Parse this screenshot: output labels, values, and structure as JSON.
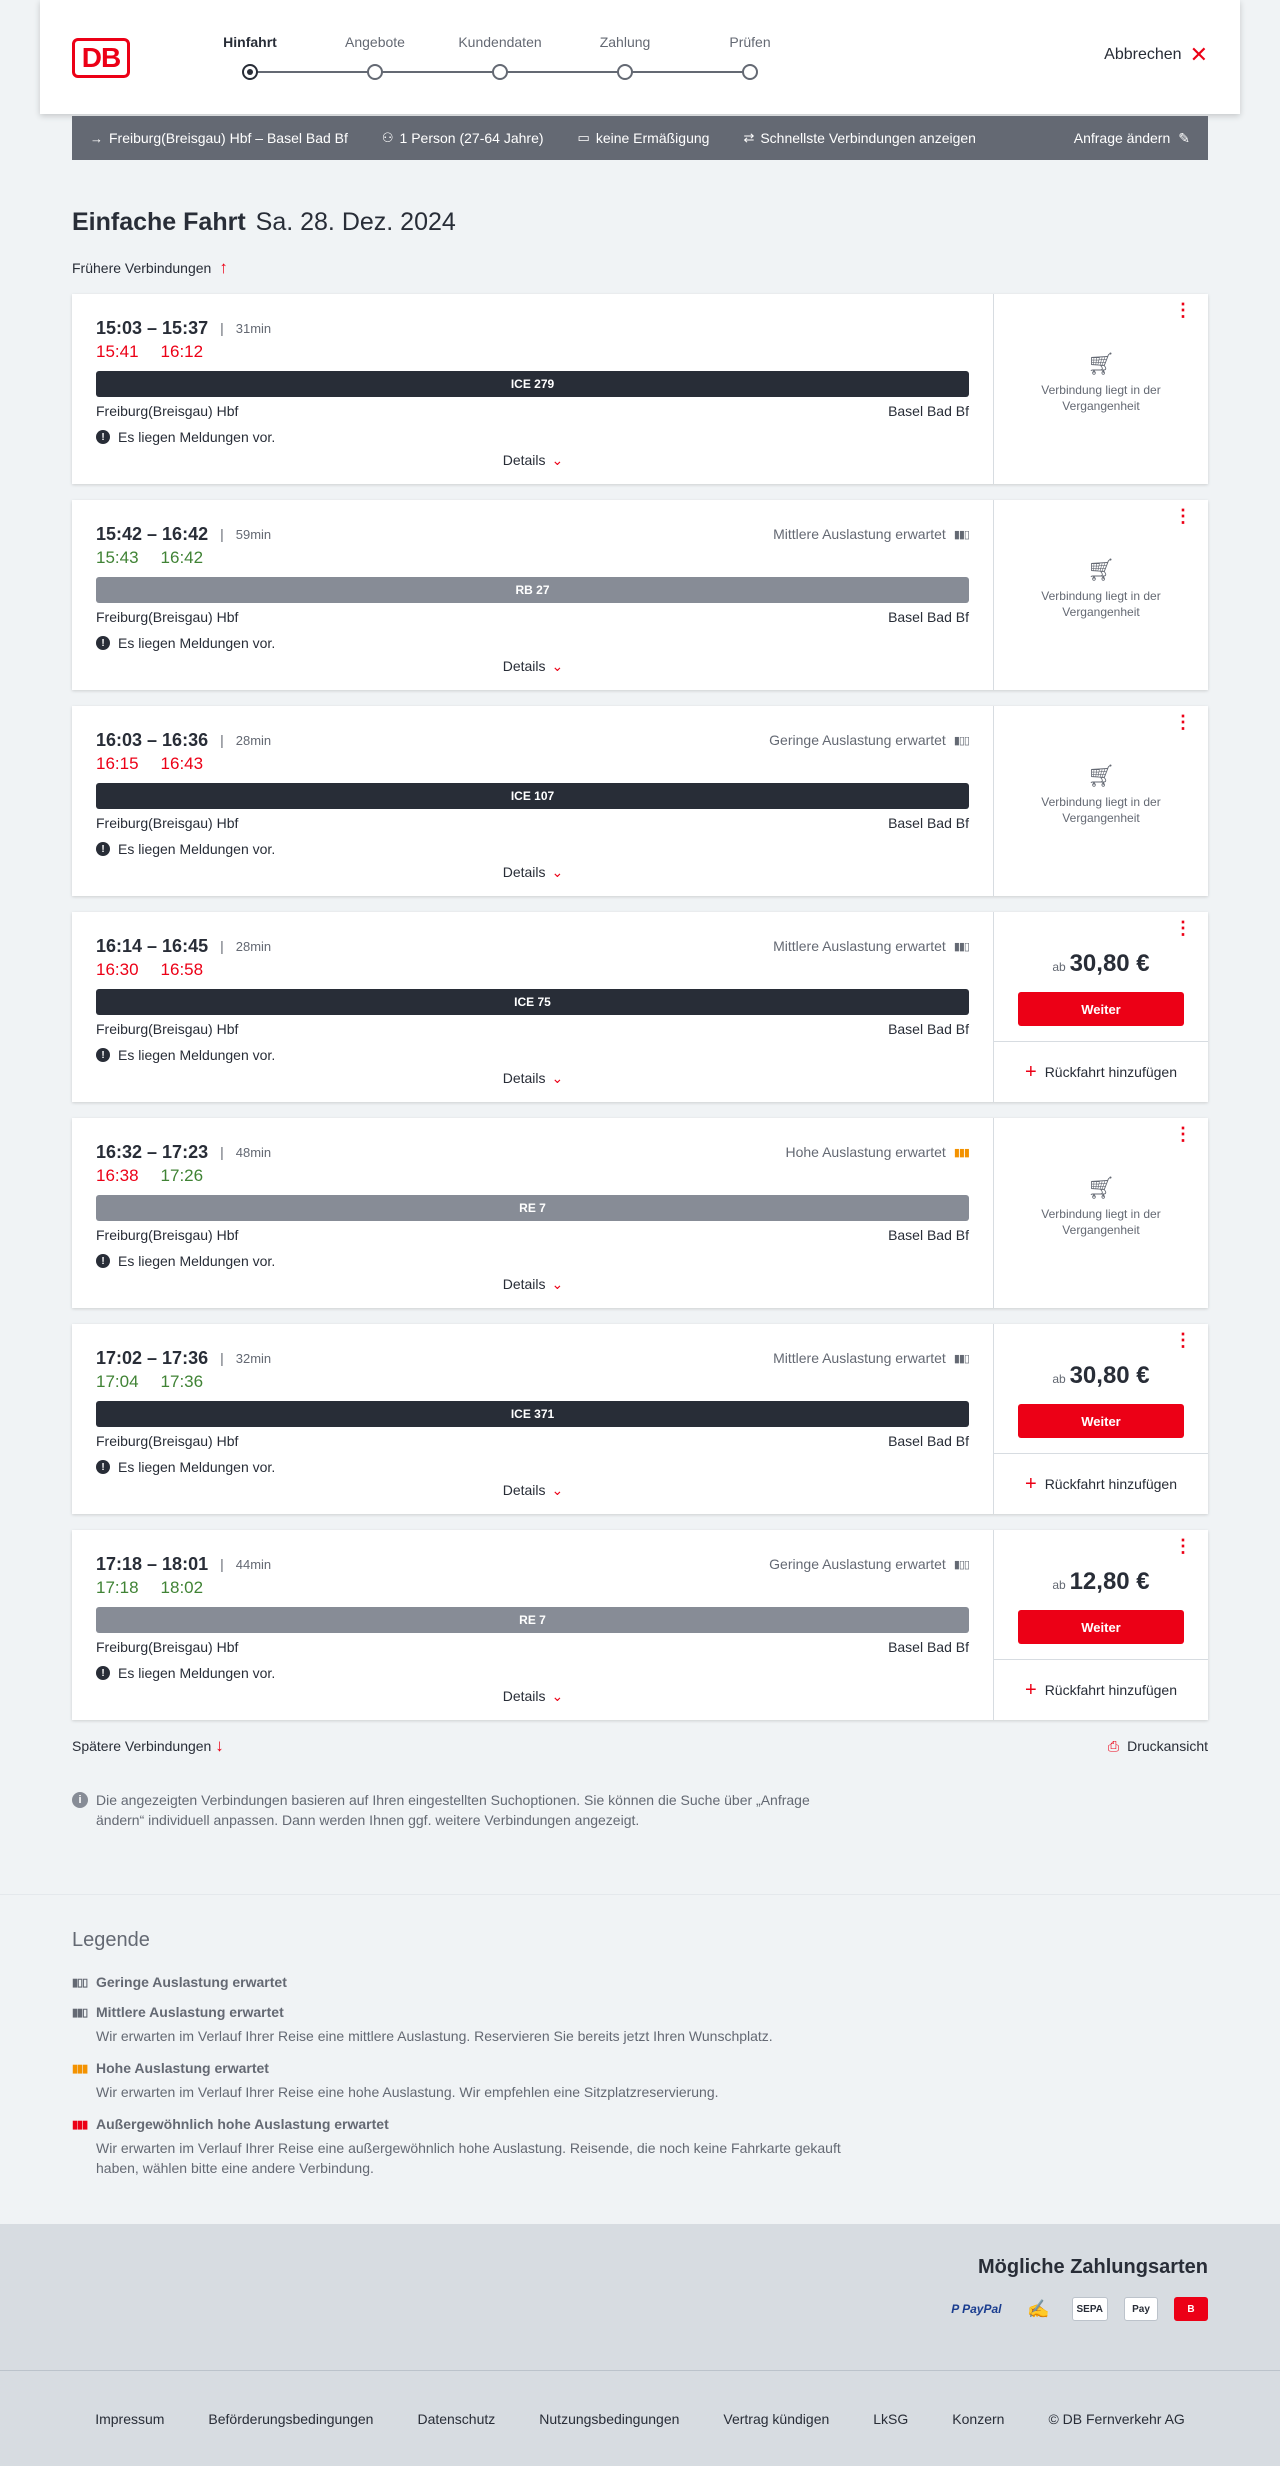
{
  "header": {
    "logo": "DB",
    "steps": [
      {
        "label": "Hinfahrt",
        "active": true
      },
      {
        "label": "Angebote",
        "active": false
      },
      {
        "label": "Kundendaten",
        "active": false
      },
      {
        "label": "Zahlung",
        "active": false
      },
      {
        "label": "Prüfen",
        "active": false
      }
    ],
    "cancel_label": "Abbrechen"
  },
  "search": {
    "route": "Freiburg(Breisgau) Hbf – Basel Bad Bf",
    "passengers": "1 Person (27-64 Jahre)",
    "discount": "keine Ermäßigung",
    "fastest": "Schnellste Verbindungen anzeigen",
    "edit": "Anfrage ändern"
  },
  "title": {
    "main": "Einfache Fahrt",
    "date": "Sa. 28. Dez. 2024"
  },
  "earlier_label": "Frühere Verbindungen",
  "later_label": "Spätere Verbindungen",
  "print_label": "Druckansicht",
  "labels": {
    "details": "Details",
    "messages": "Es liegen Meldungen vor.",
    "past": "Verbindung liegt in der Vergangenheit",
    "from_prefix": "ab",
    "weiter": "Weiter",
    "return": "Rückfahrt hinzufügen"
  },
  "connections": [
    {
      "times": "15:03 – 15:37",
      "duration": "31min",
      "rt_dep": "15:41",
      "rt_arr": "16:12",
      "dep_late": true,
      "arr_late": true,
      "load": "",
      "load_level": "",
      "train": "ICE 279",
      "kind": "ice",
      "from": "Freiburg(Breisgau) Hbf",
      "to": "Basel Bad Bf",
      "price": ""
    },
    {
      "times": "15:42 – 16:42",
      "duration": "59min",
      "rt_dep": "15:43",
      "rt_arr": "16:42",
      "dep_late": false,
      "arr_late": false,
      "load": "Mittlere Auslastung erwartet",
      "load_level": "mid",
      "train": "RB 27",
      "kind": "reg",
      "from": "Freiburg(Breisgau) Hbf",
      "to": "Basel Bad Bf",
      "price": ""
    },
    {
      "times": "16:03 – 16:36",
      "duration": "28min",
      "rt_dep": "16:15",
      "rt_arr": "16:43",
      "dep_late": true,
      "arr_late": true,
      "load": "Geringe Auslastung erwartet",
      "load_level": "low",
      "train": "ICE 107",
      "kind": "ice",
      "from": "Freiburg(Breisgau) Hbf",
      "to": "Basel Bad Bf",
      "price": ""
    },
    {
      "times": "16:14 – 16:45",
      "duration": "28min",
      "rt_dep": "16:30",
      "rt_arr": "16:58",
      "dep_late": true,
      "arr_late": true,
      "load": "Mittlere Auslastung erwartet",
      "load_level": "mid",
      "train": "ICE 75",
      "kind": "ice",
      "from": "Freiburg(Breisgau) Hbf",
      "to": "Basel Bad Bf",
      "price": "30,80 €"
    },
    {
      "times": "16:32 – 17:23",
      "duration": "48min",
      "rt_dep": "16:38",
      "rt_arr": "17:26",
      "dep_late": true,
      "arr_late": false,
      "load": "Hohe Auslastung erwartet",
      "load_level": "high",
      "train": "RE 7",
      "kind": "reg",
      "from": "Freiburg(Breisgau) Hbf",
      "to": "Basel Bad Bf",
      "price": ""
    },
    {
      "times": "17:02 – 17:36",
      "duration": "32min",
      "rt_dep": "17:04",
      "rt_arr": "17:36",
      "dep_late": false,
      "arr_late": false,
      "load": "Mittlere Auslastung erwartet",
      "load_level": "mid",
      "train": "ICE 371",
      "kind": "ice",
      "from": "Freiburg(Breisgau) Hbf",
      "to": "Basel Bad Bf",
      "price": "30,80 €"
    },
    {
      "times": "17:18 – 18:01",
      "duration": "44min",
      "rt_dep": "17:18",
      "rt_arr": "18:02",
      "dep_late": false,
      "arr_late": false,
      "load": "Geringe Auslastung erwartet",
      "load_level": "low",
      "train": "RE 7",
      "kind": "reg",
      "from": "Freiburg(Breisgau) Hbf",
      "to": "Basel Bad Bf",
      "price": "12,80 €"
    }
  ],
  "info_text": "Die angezeigten Verbindungen basieren auf Ihren eingestellten Suchoptionen. Sie können die Suche über „Anfrage ändern“ individuell anpassen. Dann werden Ihnen ggf. weitere Verbindungen angezeigt.",
  "legend": {
    "title": "Legende",
    "items": [
      {
        "level": "low",
        "title": "Geringe Auslastung erwartet",
        "desc": ""
      },
      {
        "level": "mid",
        "title": "Mittlere Auslastung erwartet",
        "desc": "Wir erwarten im Verlauf Ihrer Reise eine mittlere Auslastung. Reservieren Sie bereits jetzt Ihren Wunschplatz."
      },
      {
        "level": "high",
        "title": "Hohe Auslastung erwartet",
        "desc": "Wir erwarten im Verlauf Ihrer Reise eine hohe Auslastung. Wir empfehlen eine Sitzplatzreservierung."
      },
      {
        "level": "xhigh",
        "title": "Außergewöhnlich hohe Auslastung erwartet",
        "desc": "Wir erwarten im Verlauf Ihrer Reise eine außergewöhnlich hohe Auslastung. Reisende, die noch keine Fahrkarte gekauft haben, wählen bitte eine andere Verbindung."
      }
    ]
  },
  "payment": {
    "title": "Mögliche Zahlungsarten",
    "methods": [
      {
        "name": "paypal-icon",
        "text": "P PayPal"
      },
      {
        "name": "credit-card-icon",
        "text": "✍"
      },
      {
        "name": "sepa-icon",
        "text": "SEPA"
      },
      {
        "name": "apple-pay-icon",
        "text": " Pay"
      },
      {
        "name": "db-bonus-icon",
        "text": "B"
      }
    ]
  },
  "footer": [
    "Impressum",
    "Beförderungsbedingungen",
    "Datenschutz",
    "Nutzungsbedingungen",
    "Vertrag kündigen",
    "LkSG",
    "Konzern",
    "© DB Fernverkehr AG"
  ],
  "colors": {
    "brand": "#ec0016",
    "late": "#ec0016",
    "on_time": "#408335",
    "high_load": "#f39200"
  }
}
